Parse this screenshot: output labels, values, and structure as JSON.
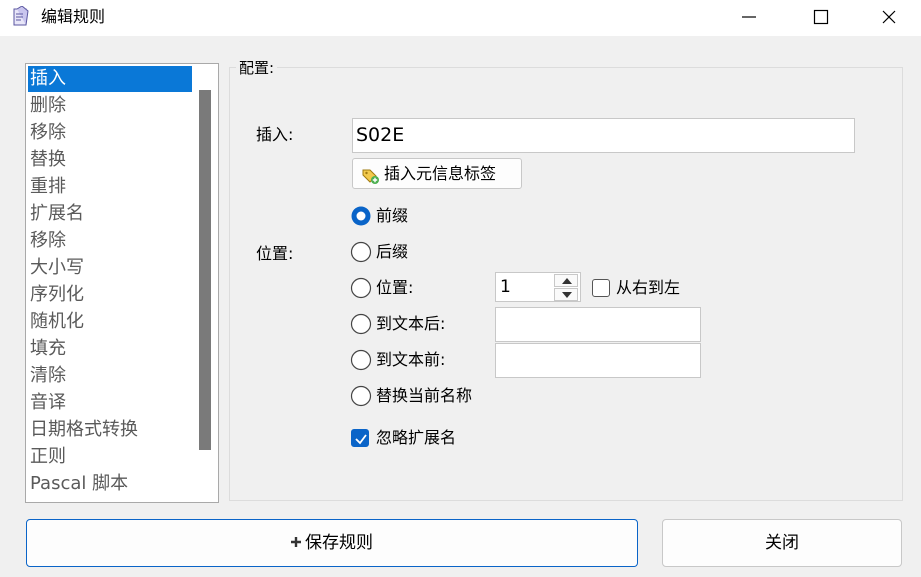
{
  "window": {
    "title": "编辑规则"
  },
  "rules_list": {
    "items": [
      "插入",
      "删除",
      "移除",
      "替换",
      "重排",
      "扩展名",
      "移除",
      "大小写",
      "序列化",
      "随机化",
      "填充",
      "清除",
      "音译",
      "日期格式转换",
      "正则",
      "Pascal 脚本"
    ],
    "selected_index": 0
  },
  "config": {
    "group_title": "配置:",
    "insert_label": "插入:",
    "insert_value": "S02E",
    "meta_tag_button": "插入元信息标签",
    "position_label": "位置:",
    "options": {
      "prefix": "前缀",
      "suffix": "后缀",
      "position": "位置:",
      "after_text": "到文本后:",
      "before_text": "到文本前:",
      "replace_name": "替换当前名称"
    },
    "selected_option": "prefix",
    "position_value": "1",
    "right_to_left_label": "从右到左",
    "right_to_left_checked": false,
    "after_text_value": "",
    "before_text_value": "",
    "ignore_extension_label": "忽略扩展名",
    "ignore_extension_checked": true
  },
  "buttons": {
    "save": "保存规则",
    "close": "关闭"
  },
  "colors": {
    "accent": "#0a64c8",
    "selection": "#0a78d7"
  }
}
